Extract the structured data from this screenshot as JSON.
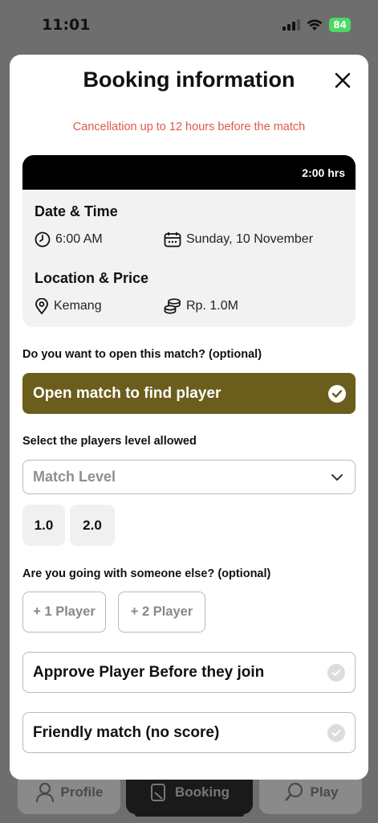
{
  "status_bar": {
    "time": "11:01",
    "battery": "84"
  },
  "tabbar": {
    "profile_label": "Profile",
    "booking_label": "Booking",
    "play_label": "Play"
  },
  "modal": {
    "title": "Booking information",
    "notice": "Cancellation up to 12 hours before the match",
    "notice_color": "#e0584d",
    "duration": "2:00 hrs",
    "datetime_title": "Date & Time",
    "time": "6:00 AM",
    "date": "Sunday, 10 November",
    "location_title": "Location & Price",
    "location": "Kemang",
    "price": "Rp. 1.0M",
    "open_question": "Do you want to open this match? (optional)",
    "open_button": "Open match to find player",
    "accent_color": "#6b5d1b",
    "level_question": "Select the players level allowed",
    "level_placeholder": "Match Level",
    "levels": [
      "1.0",
      "2.0"
    ],
    "company_question": "Are you going with someone else? (optional)",
    "plus_one": "+ 1 Player",
    "plus_two": "+ 2 Player",
    "approve_label": "Approve Player Before they join",
    "friendly_label": "Friendly match (no score)"
  }
}
